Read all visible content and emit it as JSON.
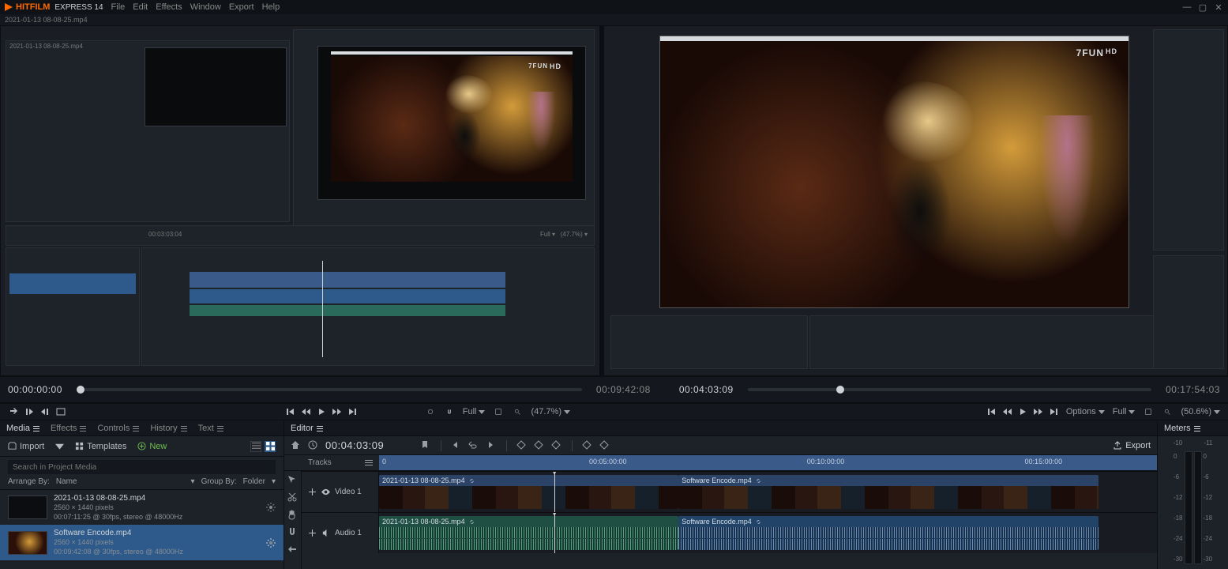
{
  "app": {
    "brand": "HITFILM",
    "sub": "EXPRESS 14",
    "project_name": "2021-01-13 08-08-25.mp4"
  },
  "menu": {
    "items": [
      "File",
      "Edit",
      "Effects",
      "Window",
      "Export",
      "Help"
    ]
  },
  "window_controls": {
    "minimize": "—",
    "maximize": "▢",
    "close": "✕"
  },
  "viewer": {
    "watermark": "7FUN",
    "watermark_hd": "HD",
    "left_tc": "00:00:00:00",
    "left_duration": "00:09:42:08",
    "right_tc": "00:04:03:09",
    "right_duration": "00:17:54:03",
    "inner_left_tc": "00:03:03:04",
    "inner_zoom": "(47.7%)",
    "options_label": "Options",
    "quality_full": "Full",
    "zoom_left": "(47.7%)",
    "zoom_right": "(50.6%)"
  },
  "panel_tabs": {
    "media": "Media",
    "effects": "Effects",
    "controls": "Controls",
    "history": "History",
    "text": "Text",
    "editor": "Editor",
    "meters": "Meters"
  },
  "media_toolbar": {
    "import": "Import",
    "templates": "Templates",
    "new": "New",
    "search_placeholder": "Search in Project Media",
    "arrange_label": "Arrange By:",
    "arrange_value": "Name",
    "group_label": "Group By:",
    "group_value": "Folder"
  },
  "media_items": [
    {
      "name": "2021-01-13 08-08-25.mp4",
      "dims": "2560 × 1440 pixels",
      "meta": "00:07:11:25 @ 30fps, stereo @ 48000Hz"
    },
    {
      "name": "Software Encode.mp4",
      "dims": "2560 × 1440 pixels",
      "meta": "00:09:42:08 @ 30fps, stereo @ 48000Hz"
    }
  ],
  "editor": {
    "tc": "00:04:03:09",
    "export_label": "Export",
    "tracks_label": "Tracks",
    "video_track": "Video 1",
    "audio_track": "Audio 1",
    "ruler": [
      "0",
      "00:05:00:00",
      "00:10:00:00",
      "00:15:00:00"
    ],
    "clips": {
      "v1_a": "2021-01-13 08-08-25.mp4",
      "v1_b": "Software Encode.mp4",
      "a1_a": "2021-01-13 08-08-25.mp4",
      "a1_b": "Software Encode.mp4"
    }
  },
  "meters": {
    "labels": [
      "-10",
      "-11",
      "0",
      "-6",
      "-12",
      "-18",
      "-24",
      "-30"
    ]
  }
}
